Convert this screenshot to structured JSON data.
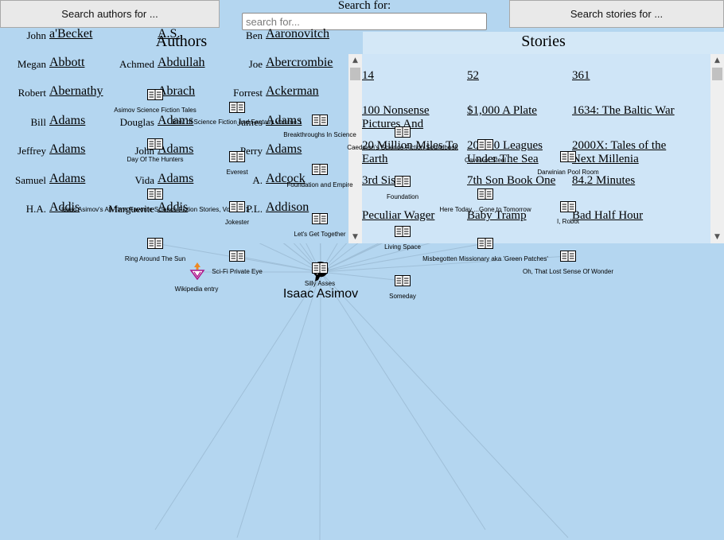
{
  "header": {
    "authors_button": "Search authors for ...",
    "search_label": "Search for:",
    "search_placeholder": "search for...",
    "stories_button": "Search stories for ..."
  },
  "authors": {
    "title": "Authors",
    "items": [
      {
        "first": "John",
        "last": "a'Becket"
      },
      {
        "first": "",
        "last": "A.S."
      },
      {
        "first": "Ben",
        "last": "Aaronovitch"
      },
      {
        "first": "Megan",
        "last": "Abbott"
      },
      {
        "first": "Achmed",
        "last": "Abdullah"
      },
      {
        "first": "Joe",
        "last": "Abercrombie"
      },
      {
        "first": "Robert",
        "last": "Abernathy"
      },
      {
        "first": "",
        "last": "Abrach"
      },
      {
        "first": "Forrest",
        "last": "Ackerman"
      },
      {
        "first": "Bill",
        "last": "Adams"
      },
      {
        "first": "Douglas",
        "last": "Adams"
      },
      {
        "first": "James",
        "last": "Adams"
      },
      {
        "first": "Jeffrey",
        "last": "Adams"
      },
      {
        "first": "John",
        "last": "Adams"
      },
      {
        "first": "Perry",
        "last": "Adams"
      },
      {
        "first": "Samuel",
        "last": "Adams"
      },
      {
        "first": "Vida",
        "last": "Adams"
      },
      {
        "first": "A.",
        "last": "Adcock"
      },
      {
        "first": "H.A.",
        "last": "Addis"
      },
      {
        "first": "Marguerite",
        "last": "Addis"
      },
      {
        "first": "P.L.",
        "last": "Addison"
      }
    ]
  },
  "stories": {
    "title": "Stories",
    "items": [
      "14",
      "52",
      "361",
      "100 Nonsense Pictures And",
      "$1,000 A Plate",
      "1634: The Baltic War",
      "20 Million Miles To Earth",
      "20,000 Leagues Under The Sea",
      "2000X: Tales of the Next Millenia",
      "3rd Sister",
      "7th Son Book One",
      "84.2 Minutes",
      "Peculiar Wager",
      "Baby Tramp",
      "Bad Half Hour"
    ]
  },
  "graph": {
    "center": "Isaac Asimov",
    "wiki": "Wikipedia entry",
    "books": [
      "Asimov Science Fiction Tales",
      "Best of Science Fiction and Fantasy Volume 1",
      "Breakthroughs In Science",
      "Caedmon's Science Fiction Soundbook",
      "Caves of Steel",
      "Darwinian Pool Room",
      "Day Of The Hunters",
      "Everest",
      "Foundation and Empire",
      "Foundation",
      "Here Today ...Gone to Tomorrow",
      "I, Robot",
      "Isaac Asimov's All-Time Favorite Science Fiction Stories, Volume 1",
      "Jokester",
      "Let's Get Together",
      "Living Space",
      "Misbegotten Missionary aka 'Green Patches'",
      "Oh, That Lost Sense Of Wonder",
      "Ring Around The Sun",
      "Sci-Fi Private Eye",
      "Silly Asses",
      "Someday"
    ]
  }
}
